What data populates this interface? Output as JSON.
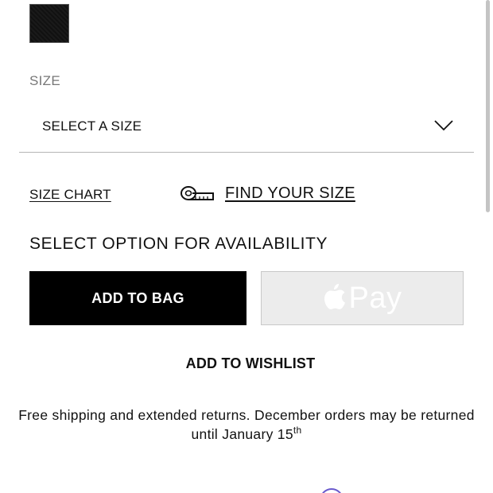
{
  "color_swatch": {
    "name": "black-swatch",
    "color": "#141414"
  },
  "size": {
    "label": "SIZE",
    "select_value": "SELECT A SIZE"
  },
  "links": {
    "size_chart": "SIZE CHART",
    "find_your_size": "FIND YOUR SIZE"
  },
  "availability": "SELECT OPTION FOR AVAILABILITY",
  "buttons": {
    "add_to_bag": "ADD TO BAG",
    "apple_pay": "Pay",
    "add_to_wishlist": "ADD TO WISHLIST"
  },
  "shipping": {
    "text_before": "Free shipping and extended returns. December orders may be returned until January 15",
    "superscript": "th"
  },
  "icons": {
    "chevron": "chevron-down-icon",
    "tape": "measuring-tape-icon",
    "apple": "apple-logo-icon"
  },
  "colors": {
    "primary_button": "#000000",
    "apple_pay_bg": "#ececec",
    "divider": "#b5b5b5"
  }
}
